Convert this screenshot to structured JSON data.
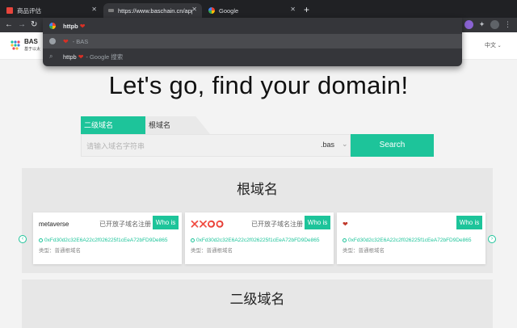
{
  "browser": {
    "tabs": [
      {
        "title": "商品评估",
        "active": false
      },
      {
        "title": "https://www.baschain.cn/app/",
        "active": true
      },
      {
        "title": "Google",
        "active": false
      }
    ],
    "new_tab": "+"
  },
  "omnibox": {
    "suggestions": [
      {
        "text": "httpb",
        "suffix": "",
        "icon": "google-icon"
      },
      {
        "text": "",
        "suffix": "- BAS",
        "icon": "bas-favicon-icon"
      },
      {
        "text": "httpb",
        "suffix": "- Google 搜索",
        "icon": "search-icon"
      }
    ],
    "heart": "❤"
  },
  "header": {
    "logo_text": "BAS",
    "logo_sub": "基于以太",
    "language": "中文"
  },
  "hero": {
    "title": "Let's go, find your domain!"
  },
  "search": {
    "tab_sub": "二级域名",
    "tab_root": "根域名",
    "placeholder": "请输入域名字符串",
    "suffix": ".bas",
    "button": "Search"
  },
  "root_panel": {
    "title": "根域名",
    "cards": [
      {
        "name": "metaverse",
        "tag": "已开放子域名注册",
        "who": "Who is",
        "address": "0xFd30d2c32E6A22c2f026225f1cEeA72bFD9De865",
        "type": "类型：普通根域名"
      },
      {
        "name": "❌❌⭕⭕",
        "tag": "已开放子域名注册",
        "who": "Who is",
        "address": "0xFd30d2c32E6A22c2f026225f1cEeA72bFD9De865",
        "type": "类型：普通根域名"
      },
      {
        "name": "❤",
        "tag": "",
        "who": "Who is",
        "address": "0xFd30d2c32E6A22c2f026225f1cEeA72bFD9De865",
        "type": "类型：普通根域名"
      }
    ]
  },
  "sub_panel": {
    "title": "二级域名"
  },
  "colors": {
    "accent": "#1dc49a",
    "chrome_dark": "#202124",
    "chrome_toolbar": "#35363a"
  }
}
